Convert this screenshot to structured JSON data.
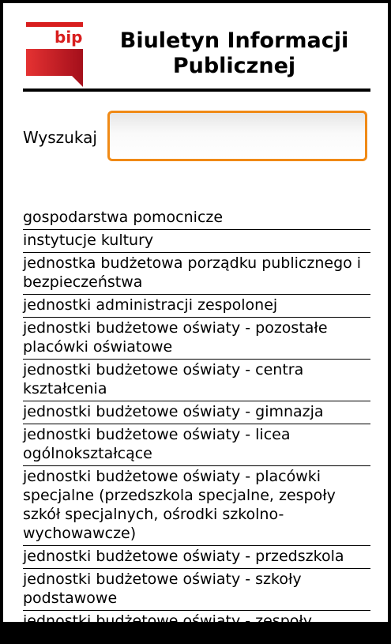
{
  "header": {
    "logo_text": "bip",
    "title": "Biuletyn Informacji Publicznej"
  },
  "search": {
    "label": "Wyszukaj",
    "value": ""
  },
  "categories": [
    "gospodarstwa pomocnicze",
    "instytucje kultury",
    "jednostka budżetowa porządku publicznego i bezpieczeństwa",
    "jednostki administracji zespolonej",
    "jednostki budżetowe oświaty - pozostałe placówki oświatowe",
    "jednostki budżetowe oświaty - centra kształcenia",
    "jednostki budżetowe oświaty - gimnazja",
    "jednostki budżetowe oświaty - licea ogólnokształcące",
    "jednostki budżetowe oświaty - placówki specjalne (przedszkola specjalne, zespoły szkół specjalnych, ośrodki szkolno-wychowawcze)",
    "jednostki budżetowe oświaty - przedszkola",
    "jednostki budżetowe oświaty - szkoły podstawowe",
    "jednostki budżetowe oświaty - zespoły szkolno-"
  ],
  "colors": {
    "logo_red": "#d81e1e",
    "input_border": "#f08a16"
  }
}
